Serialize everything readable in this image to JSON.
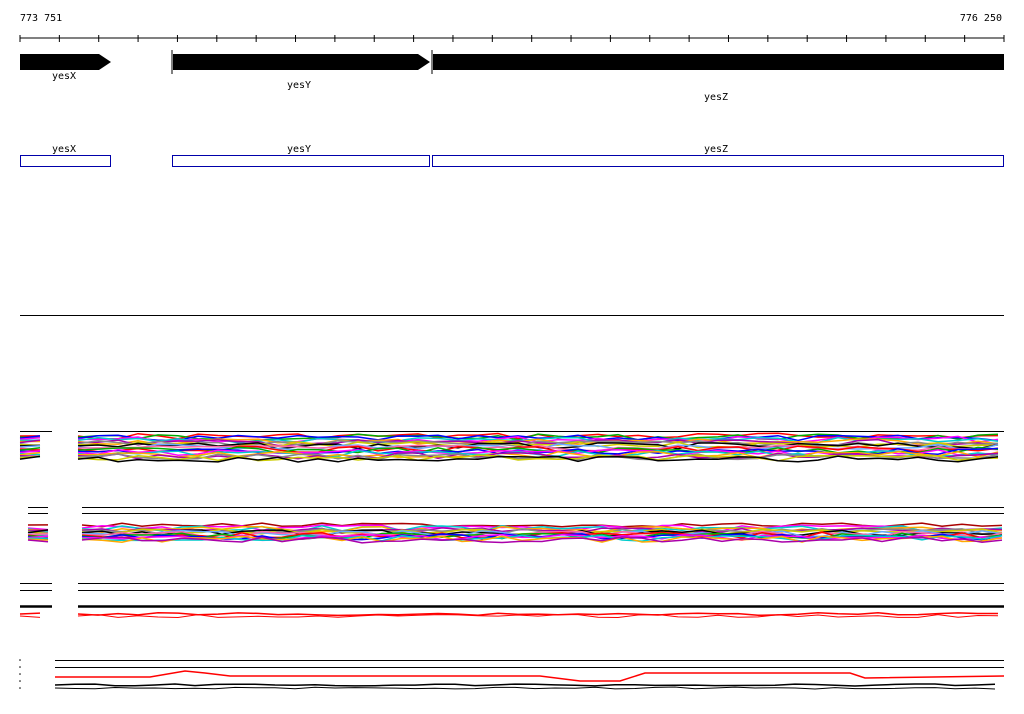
{
  "ruler": {
    "start": "773 751",
    "end": "776 250",
    "tick_count": 26
  },
  "genes": [
    {
      "name": "yesX",
      "strand": "+"
    },
    {
      "name": "yesY",
      "strand": "+"
    },
    {
      "name": "yesZ",
      "strand": "+"
    }
  ],
  "cds_boxes": [
    {
      "name": "yesX"
    },
    {
      "name": "yesY"
    },
    {
      "name": "yesZ"
    }
  ],
  "colors": {
    "gene_arrow": "#000000",
    "cds_outline": "#0000aa",
    "track_primary": "#ff0000",
    "track_secondary": "#000000",
    "palette": [
      "#ff0000",
      "#00aa00",
      "#0000ff",
      "#ff00ff",
      "#00cccc",
      "#ffaa00",
      "#aa00aa",
      "#888888",
      "#cccc00",
      "#000000",
      "#66aaff",
      "#ff66aa"
    ]
  }
}
